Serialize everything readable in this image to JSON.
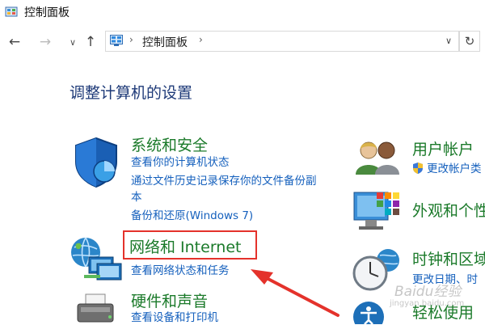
{
  "window": {
    "title": "控制面板"
  },
  "nav": {
    "back_glyph": "←",
    "forward_glyph": "→",
    "recent_glyph": "∨",
    "up_glyph": "↑",
    "address_sep": "›",
    "address_path": "控制面板",
    "dropdown_glyph": "∨",
    "refresh_glyph": "↻"
  },
  "heading": "调整计算机的设置",
  "left_categories": [
    {
      "title": "系统和安全",
      "icon": "shield-icon",
      "links": [
        "查看你的计算机状态",
        "通过文件历史记录保存你的文件备份副",
        "本",
        "备份和还原(Windows 7)"
      ]
    },
    {
      "title": "网络和 Internet",
      "icon": "network-icon",
      "links": [
        "查看网络状态和任务"
      ]
    },
    {
      "title": "硬件和声音",
      "icon": "printer-icon",
      "links": [
        "查看设备和打印机"
      ]
    }
  ],
  "right_categories": [
    {
      "title": "用户帐户",
      "icon": "users-icon",
      "links": [
        "更改帐户类"
      ]
    },
    {
      "title": "外观和个性",
      "icon": "monitor-icon",
      "links": []
    },
    {
      "title": "时钟和区域",
      "icon": "clock-icon",
      "links": [
        "更改日期、时"
      ]
    },
    {
      "title": "轻松使用",
      "icon": "accessibility-icon",
      "links": []
    }
  ],
  "annotation": {
    "highlight_color": "#e4322b"
  },
  "watermark": {
    "main": "Baidu经验",
    "sub": "jingyan.baidu.com"
  },
  "colors": {
    "title_green": "#1b7a2a",
    "link_blue": "#1560bd",
    "heading_navy": "#1e3a78"
  }
}
